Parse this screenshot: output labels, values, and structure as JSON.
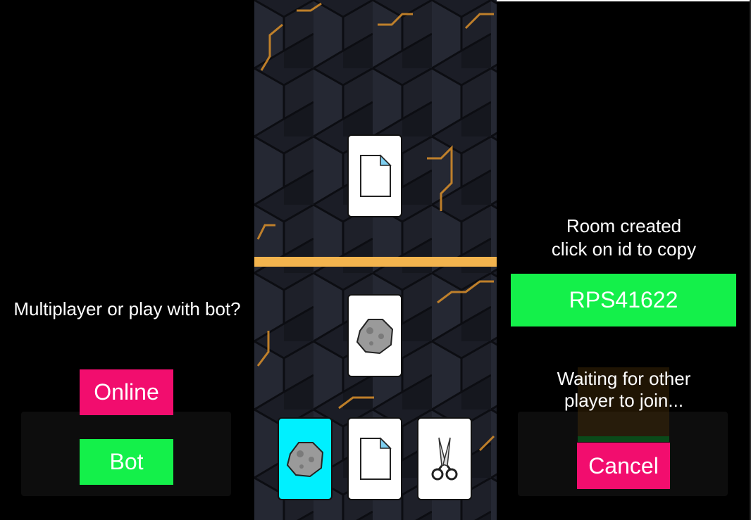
{
  "left": {
    "prompt": "Multiplayer or play with bot?",
    "online_label": "Online",
    "bot_label": "Bot"
  },
  "center": {
    "opponent_card": "paper-icon",
    "player_card": "rock-icon",
    "hand": [
      "rock-icon",
      "paper-icon",
      "scissors-icon"
    ],
    "selected_hand_index": 0
  },
  "right": {
    "room_line1": "Room created",
    "room_line2": "click on id to copy",
    "room_id": "RPS41622",
    "waiting_line1": "Waiting for other",
    "waiting_line2": "player to join...",
    "cancel_label": "Cancel"
  },
  "colors": {
    "pink": "#f20d6e",
    "green": "#14f04a",
    "gold": "#f3b44e",
    "cyan": "#00f0ff"
  }
}
